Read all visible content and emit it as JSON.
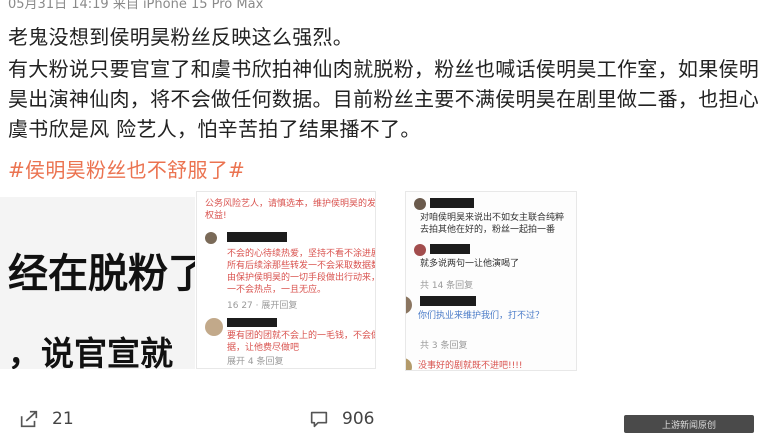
{
  "post": {
    "meta": "05月31日 14:19  来自 iPhone 15 Pro Max",
    "paragraphs": [
      "老鬼没想到侯明昊粉丝反映这么强烈。",
      "有大粉说只要官宣了和虞书欣拍神仙肉就脱粉，粉丝也喊话侯明昊工作室，如果侯明昊出演神仙肉，将不会做任何数据。目前粉丝主要不满侯明昊在剧里做二番，也担心虞书欣是风 险艺人，怕辛苦拍了结果播不了。"
    ],
    "hashtag": "#侯明昊粉丝也不舒服了#"
  },
  "images": {
    "big_text_1": "经在脱粉了",
    "big_text_2": "，说官宣就",
    "shot_a": {
      "lines": [
        "公务风险艺人，请慎选本，维护侯明昊的发展",
        "权益!",
        "不会的心待续热爱，坚持不看不涂进剧",
        "所有后续涂那些转发一不会采取数据数，",
        "由保护侯明昊的一切手段做出行动来，",
        "一不会热点，一且无应。",
        "16 27 · 展开回复",
        "要有团的团就不会上的一毛钱，不会做一下数",
        "据，让他费尽做吧",
        "展开 4 条回复"
      ]
    },
    "shot_b": {
      "lines": [
        "对咱侯明昊来说出不如女主联合纯粹",
        "去拍其他在好的，粉丝一起拍一番",
        "就多说两句一让他演喝了",
        "共 14 条回复",
        "你们执业来维护我们，打不过？",
        "共 3 条回复",
        "没事好的剧就既不进吧!!!!"
      ]
    }
  },
  "actions": {
    "share_count": "21",
    "comment_count": "906"
  },
  "watermark": "上游新闻原创"
}
